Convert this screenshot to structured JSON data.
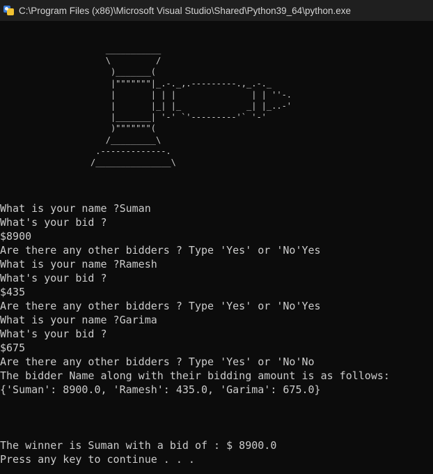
{
  "window": {
    "title": "C:\\Program Files (x86)\\Microsoft Visual Studio\\Shared\\Python39_64\\python.exe",
    "icon": "python-app-icon"
  },
  "console": {
    "ascii_art": "                     ___________\n                     \\         /\n                      )_______(\n                      |\"\"\"\"\"\"\"|_.-._,.---------.,_.-._\n                      |       | | |               | | ''-.\n                      |       |_| |_             _| |_..-'\n                      |_______| '-' `'---------'` '-'\n                      )\"\"\"\"\"\"\"(\n                     /_________\\\n                   .-------------.\n                  /_______________\\",
    "lines": [
      "What is your name ?Suman",
      "What's your bid ?",
      "$8900",
      "Are there any other bidders ? Type 'Yes' or 'No'Yes",
      "What is your name ?Ramesh",
      "What's your bid ?",
      "$435",
      "Are there any other bidders ? Type 'Yes' or 'No'Yes",
      "What is your name ?Garima",
      "What's your bid ?",
      "$675",
      "Are there any other bidders ? Type 'Yes' or 'No'No",
      "The bidder Name along with their bidding amount is as follows:",
      "{'Suman': 8900.0, 'Ramesh': 435.0, 'Garima': 675.0}",
      "",
      "",
      "",
      "The winner is Suman with a bid of : $ 8900.0",
      "Press any key to continue . . ."
    ]
  },
  "colors": {
    "background": "#0c0c0c",
    "titlebar": "#1f1f1f",
    "text": "#cccccc"
  }
}
